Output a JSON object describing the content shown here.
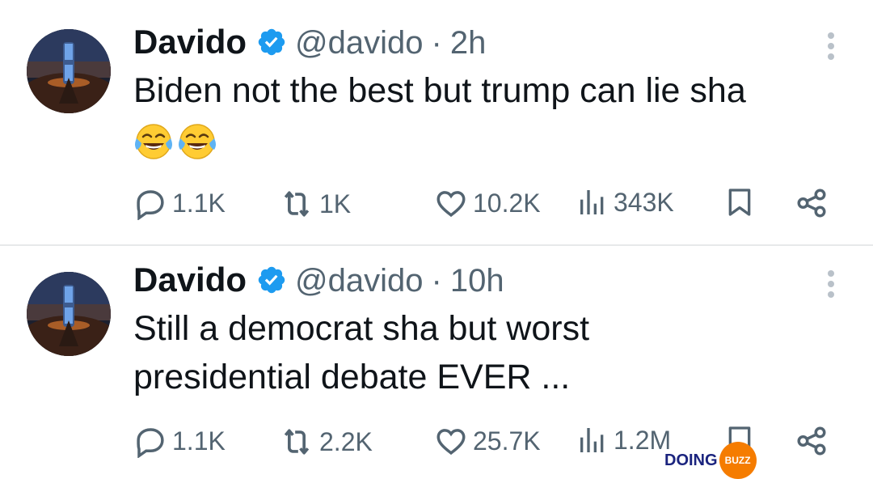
{
  "brand": {
    "verified_color": "#1d9bf0",
    "muted_color": "#536471",
    "watermark_orange": "#f57c00"
  },
  "tweets": [
    {
      "author": "Davido",
      "handle": "@davido",
      "separator": "·",
      "time": "2h",
      "text": "Biden not the best but trump can lie sha",
      "emojis": [
        "face-with-tears-of-joy",
        "face-with-tears-of-joy"
      ],
      "stats": {
        "replies": "1.1K",
        "reposts": "1K",
        "likes": "10.2K",
        "views": "343K"
      }
    },
    {
      "author": "Davido",
      "handle": "@davido",
      "separator": "·",
      "time": "10h",
      "text_line1": "Still a democrat sha but worst",
      "text_line2": "presidential debate EVER ...",
      "stats": {
        "replies": "1.1K",
        "reposts": "2.2K",
        "likes": "25.7K",
        "views": "1.2M"
      }
    }
  ],
  "watermark": {
    "part1": "DOING",
    "part2": "BUZZ"
  }
}
